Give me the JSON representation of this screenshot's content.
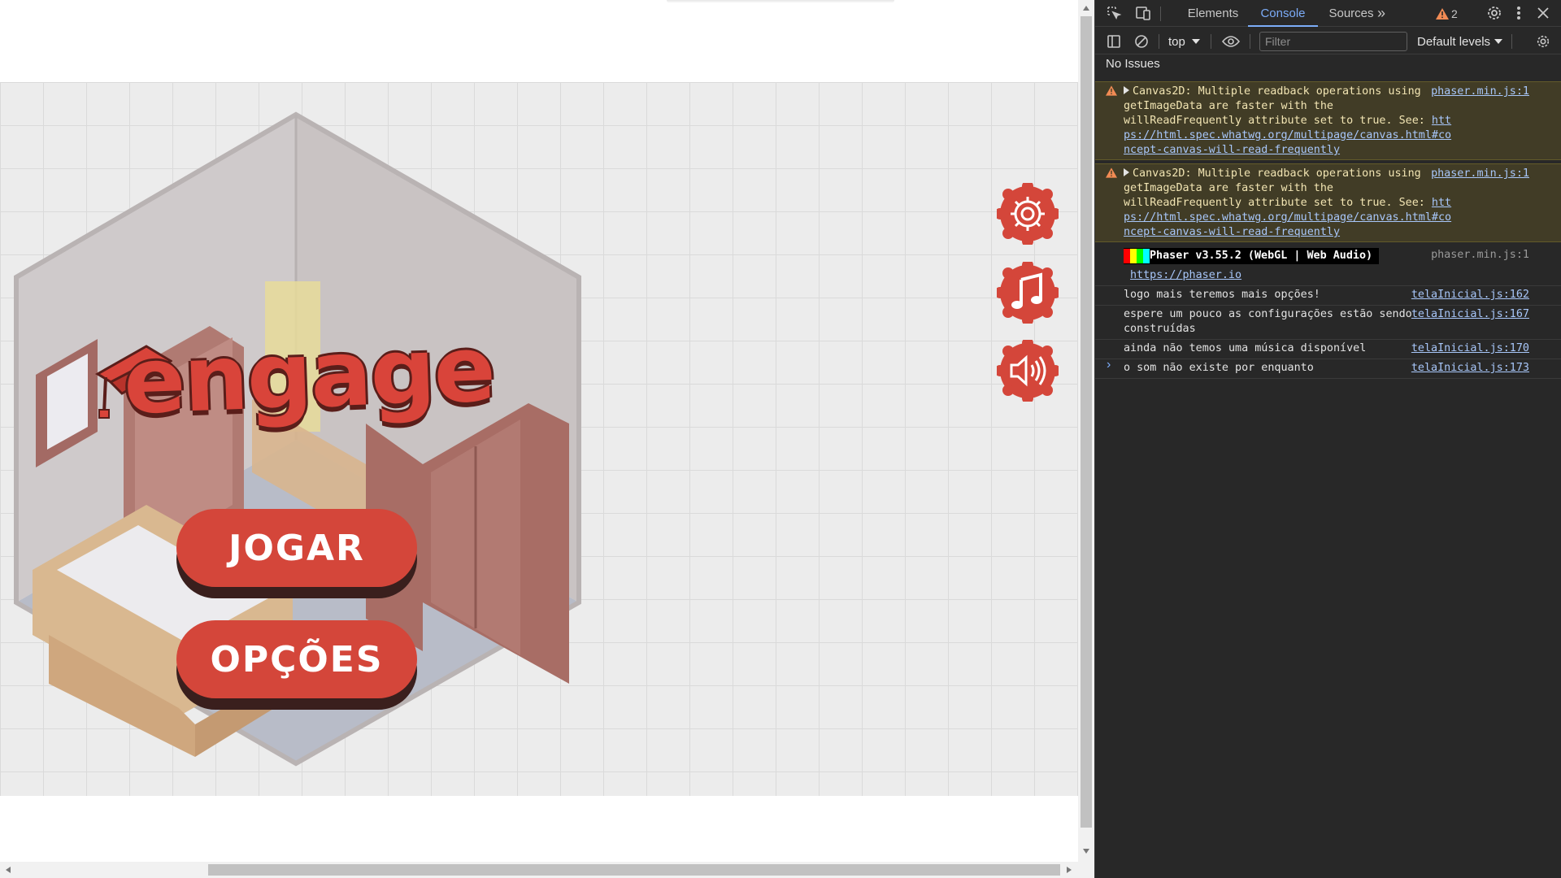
{
  "game": {
    "logo_text": "engage",
    "play_label": "JOGAR",
    "options_label": "OPÇÕES",
    "round_buttons": [
      "settings",
      "music",
      "sound"
    ]
  },
  "devtools": {
    "tabs": {
      "elements": "Elements",
      "console": "Console",
      "sources": "Sources",
      "more": "»"
    },
    "warning_count": "2",
    "toolbar": {
      "context": "top",
      "filter_placeholder": "Filter",
      "levels": "Default levels"
    },
    "issues_text": "No Issues",
    "messages": {
      "warn1": {
        "text": "Canvas2D: Multiple readback operations using getImageData are faster with the willReadFrequently attribute set to true. See: ",
        "link": "https://html.spec.whatwg.org/multipage/canvas.html#concept-canvas-will-read-frequently",
        "source": "phaser.min.js:1"
      },
      "warn2": {
        "text": "Canvas2D: Multiple readback operations using getImageData are faster with the willReadFrequently attribute set to true. See: ",
        "link": "https://html.spec.whatwg.org/multipage/canvas.html#concept-canvas-will-read-frequently",
        "source": "phaser.min.js:1"
      },
      "phaser": {
        "text": " Phaser v3.55.2 (WebGL | Web Audio) ",
        "link": "https://phaser.io",
        "source": "phaser.min.js:1"
      },
      "log1": {
        "text": "logo mais teremos mais opções!",
        "source": "telaInicial.js:162"
      },
      "log2": {
        "text": "espere um pouco as configurações estão sendo construídas",
        "source": "telaInicial.js:167"
      },
      "log3": {
        "text": "ainda não temos uma música disponível",
        "source": "telaInicial.js:170"
      },
      "log4": {
        "text": "o som não existe por enquanto",
        "source": "telaInicial.js:173"
      }
    },
    "prompt": "›"
  },
  "colors": {
    "button_red": "#d4463a",
    "console_warn_bg": "#413c26",
    "devtools_bg": "#282828",
    "accent_blue": "#7cacf8"
  }
}
